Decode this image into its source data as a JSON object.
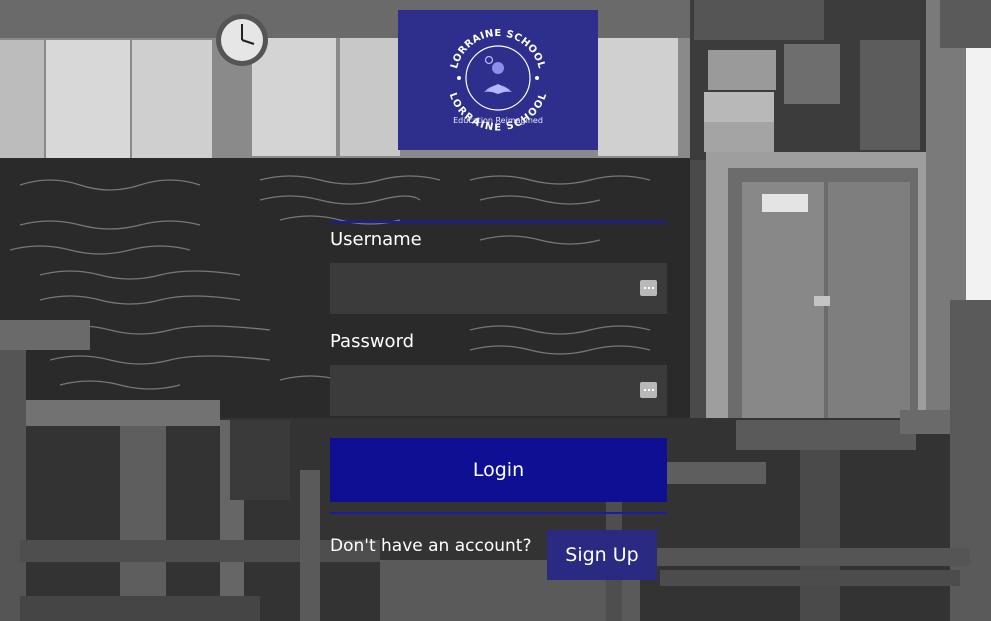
{
  "logo": {
    "school_name": "LORRAINE SCHOOL",
    "tagline": "Education Reimagined"
  },
  "form": {
    "username_label": "Username",
    "username_value": "",
    "password_label": "Password",
    "password_value": "",
    "login_label": "Login"
  },
  "signup": {
    "prompt": "Don't have an account?",
    "button_label": "Sign Up"
  },
  "colors": {
    "logo_bg": "#2e2e8c",
    "login_button": "#0f0f94",
    "signup_button": "#2b2a82",
    "field_bg": "#3b3b3b"
  }
}
